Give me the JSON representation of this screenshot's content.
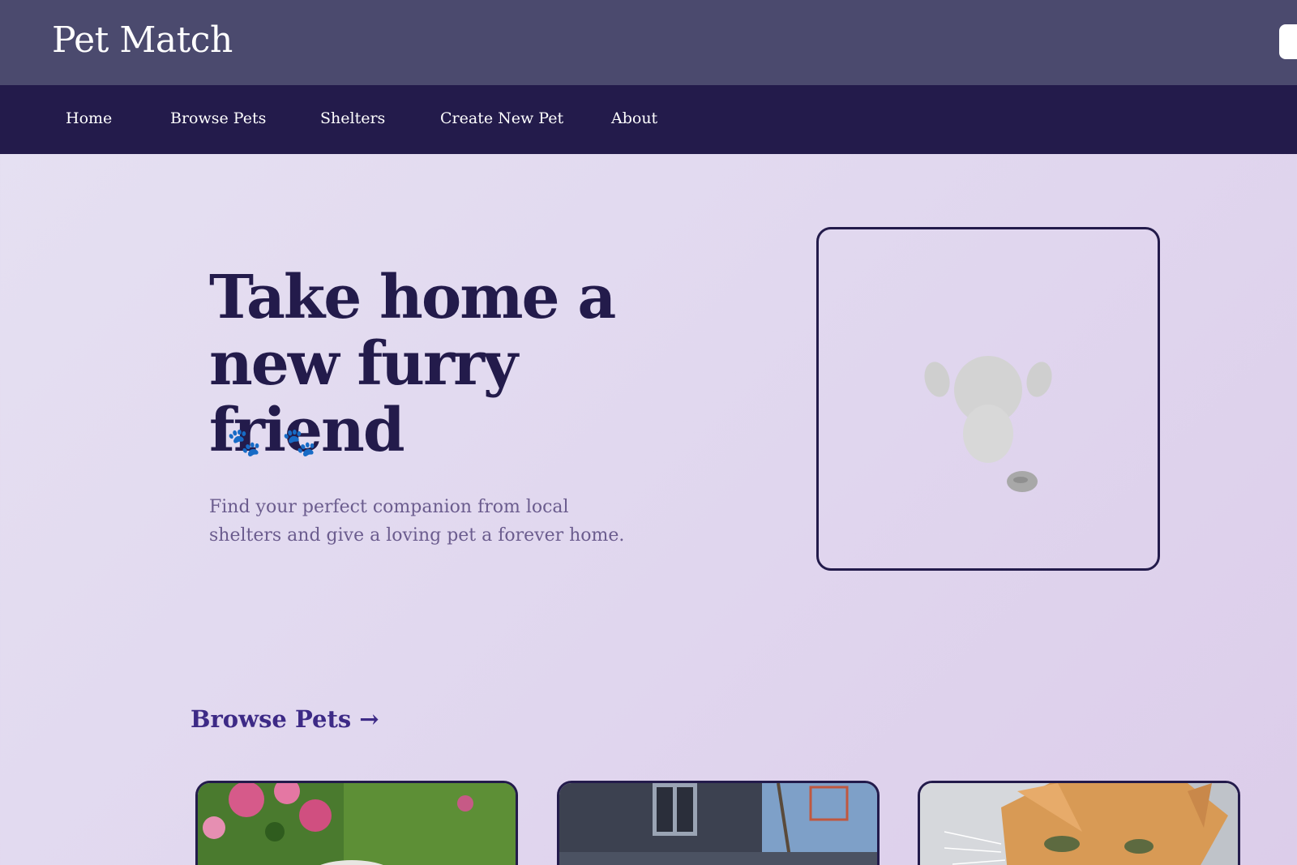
{
  "header": {
    "brand": "Pet Match"
  },
  "nav": {
    "items": [
      {
        "label": "Home"
      },
      {
        "label": "Browse Pets"
      },
      {
        "label": "Shelters"
      },
      {
        "label": "Create New Pet"
      },
      {
        "label": "About"
      }
    ]
  },
  "hero": {
    "title_line1": "Take home a",
    "title_line2": "new furry friend",
    "paws": "🐾🐾",
    "subtitle": "Find your perfect companion from local shelters and give a loving pet a forever home.",
    "image_icon": "dog-illustration-icon"
  },
  "browse": {
    "link_label": "Browse Pets →",
    "cards": [
      {
        "image_icon": "dog-in-flowers-photo"
      },
      {
        "image_icon": "dog-outside-house-photo"
      },
      {
        "image_icon": "orange-cat-photo"
      }
    ]
  },
  "colors": {
    "topbar": "#4b4a6e",
    "navbar": "#231b4b",
    "title": "#231b4b",
    "subtitle": "#6b5c8e",
    "link": "#3d2a86"
  }
}
